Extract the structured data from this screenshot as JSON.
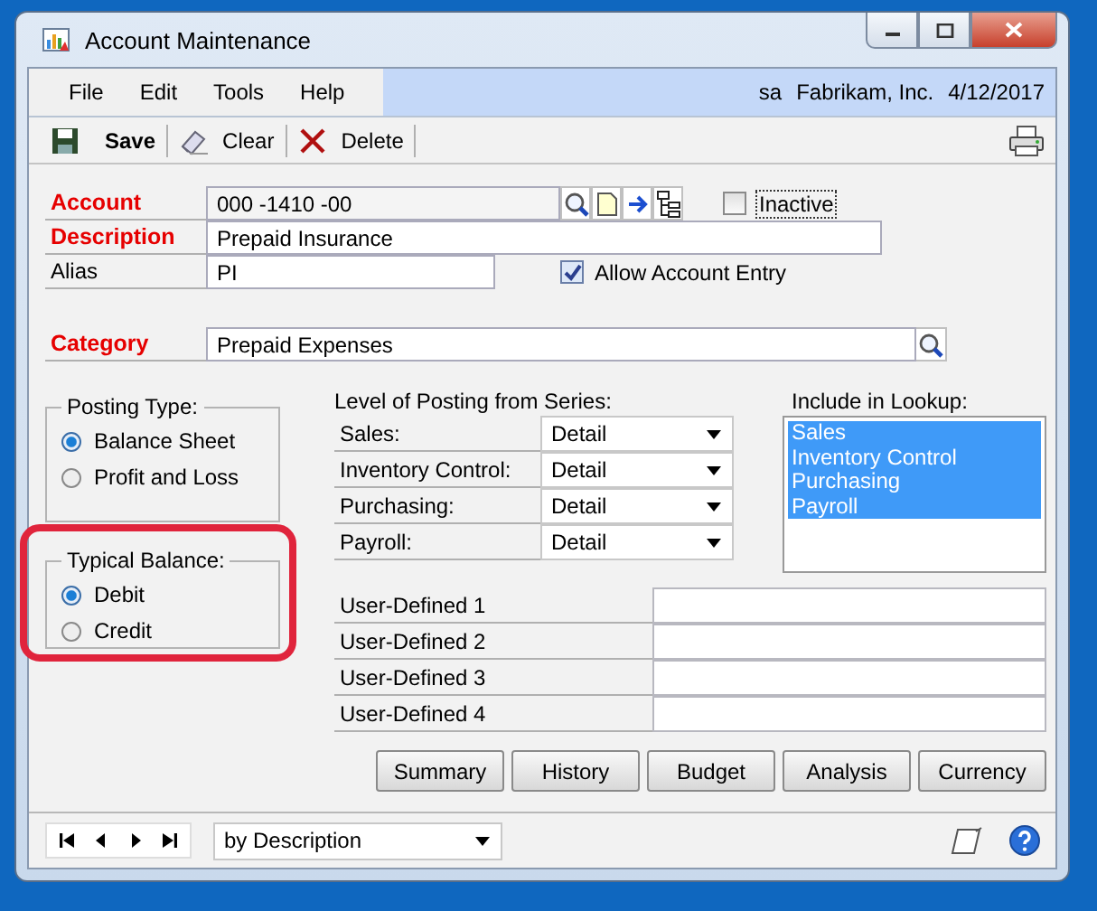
{
  "window": {
    "title": "Account Maintenance"
  },
  "menu": [
    {
      "label": "File"
    },
    {
      "label": "Edit"
    },
    {
      "label": "Tools"
    },
    {
      "label": "Help"
    }
  ],
  "session": {
    "user": "sa",
    "company": "Fabrikam, Inc.",
    "date": "4/12/2017"
  },
  "toolbar": [
    {
      "kind": "save",
      "label": "Save"
    },
    {
      "kind": "clear",
      "label": "Clear"
    },
    {
      "kind": "delete",
      "label": "Delete"
    }
  ],
  "account": {
    "label": "Account",
    "required": true,
    "value": "000 -1410 -00"
  },
  "inactive": {
    "label": "Inactive",
    "checked": false
  },
  "description": {
    "label": "Description",
    "required": true,
    "value": "Prepaid Insurance"
  },
  "alias": {
    "label": "Alias",
    "required": false,
    "value": "PI"
  },
  "allow_account_entry": {
    "label": "Allow Account Entry",
    "checked": true
  },
  "category": {
    "label": "Category",
    "required": true,
    "value": "Prepaid Expenses"
  },
  "posting_type": {
    "title": "Posting Type:",
    "options": [
      {
        "label": "Balance Sheet",
        "selected": true
      },
      {
        "label": "Profit and Loss",
        "selected": false
      }
    ]
  },
  "typical_balance": {
    "title": "Typical Balance:",
    "options": [
      {
        "label": "Debit",
        "selected": true
      },
      {
        "label": "Credit",
        "selected": false
      }
    ]
  },
  "level_of_posting": {
    "title": "Level of Posting from Series:",
    "rows": [
      {
        "label": "Sales:",
        "value": "Detail"
      },
      {
        "label": "Inventory Control:",
        "value": "Detail"
      },
      {
        "label": "Purchasing:",
        "value": "Detail"
      },
      {
        "label": "Payroll:",
        "value": "Detail"
      }
    ]
  },
  "include_in_lookup": {
    "title": "Include in Lookup:",
    "items": [
      {
        "label": "Sales",
        "selected": true
      },
      {
        "label": "Inventory Control",
        "selected": true
      },
      {
        "label": "Purchasing",
        "selected": true
      },
      {
        "label": "Payroll",
        "selected": true
      }
    ]
  },
  "user_defined": [
    {
      "label": "User-Defined 1"
    },
    {
      "label": "User-Defined 2"
    },
    {
      "label": "User-Defined 3"
    },
    {
      "label": "User-Defined 4"
    }
  ],
  "buttons": [
    {
      "label": "Summary"
    },
    {
      "label": "History"
    },
    {
      "label": "Budget"
    },
    {
      "label": "Analysis"
    },
    {
      "label": "Currency"
    }
  ],
  "browse": {
    "sort": "by Description"
  }
}
